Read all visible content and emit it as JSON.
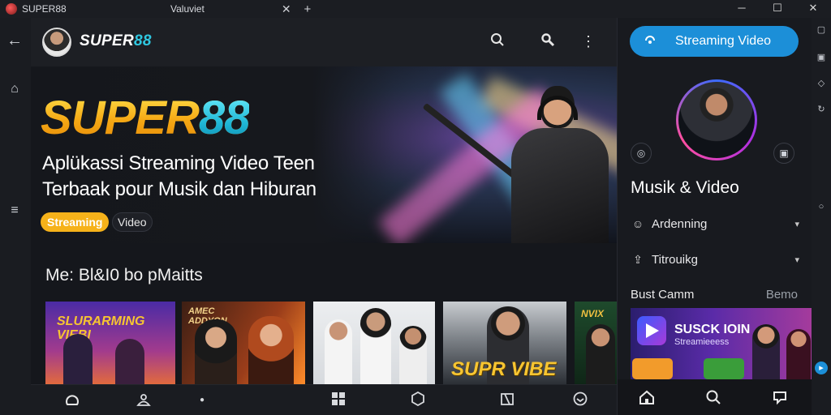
{
  "window": {
    "tabs": [
      {
        "title": "SUPER88",
        "close": "✕"
      },
      {
        "title": "Valuviet",
        "close": "✕"
      }
    ],
    "new_tab": "+",
    "controls": {
      "minimize": "─",
      "maximize": "☐",
      "close": "✕"
    }
  },
  "header": {
    "brand_text": "SUPER",
    "brand_num": "88",
    "icons": [
      "search-icon",
      "zoom-icon",
      "more-icon"
    ]
  },
  "hero": {
    "logo_text": "SUPER",
    "logo_num": "88",
    "headline_line1": "Aplükassi Streaming Video Teen",
    "headline_line2": "Terbaak pour Musik dan Hiburan",
    "tag_primary": "Streaming",
    "tag_secondary": "Video"
  },
  "section": {
    "title": "Me: Bl&I0 bo pMaitts"
  },
  "cards": [
    {
      "text": "SLURARMING VIEBI",
      "accent": "#f7c531"
    },
    {
      "text": "AMEC ADDYON",
      "accent": "#f2d28a"
    },
    {
      "text": "",
      "accent": "#ffffff"
    },
    {
      "text": "SUPR VIBE",
      "accent": "#f7c531"
    },
    {
      "text": "NVIX",
      "accent": "#f0c040"
    }
  ],
  "panel": {
    "stream_button": "Streaming Video",
    "title": "Musik & Video",
    "rows": [
      {
        "label": "Ardenning",
        "icon": "smile-icon"
      },
      {
        "label": "Titrouikg",
        "icon": "share-icon"
      }
    ],
    "subtitle": "Bust Camm",
    "subtitle_link": "Bemo",
    "promo_title": "SUSCK IOIN",
    "promo_sub": "Streamieeess"
  },
  "colors": {
    "accent_blue": "#1c8fd8",
    "logo_yellow": "#f6b21a",
    "logo_cyan": "#2fc7e0"
  }
}
